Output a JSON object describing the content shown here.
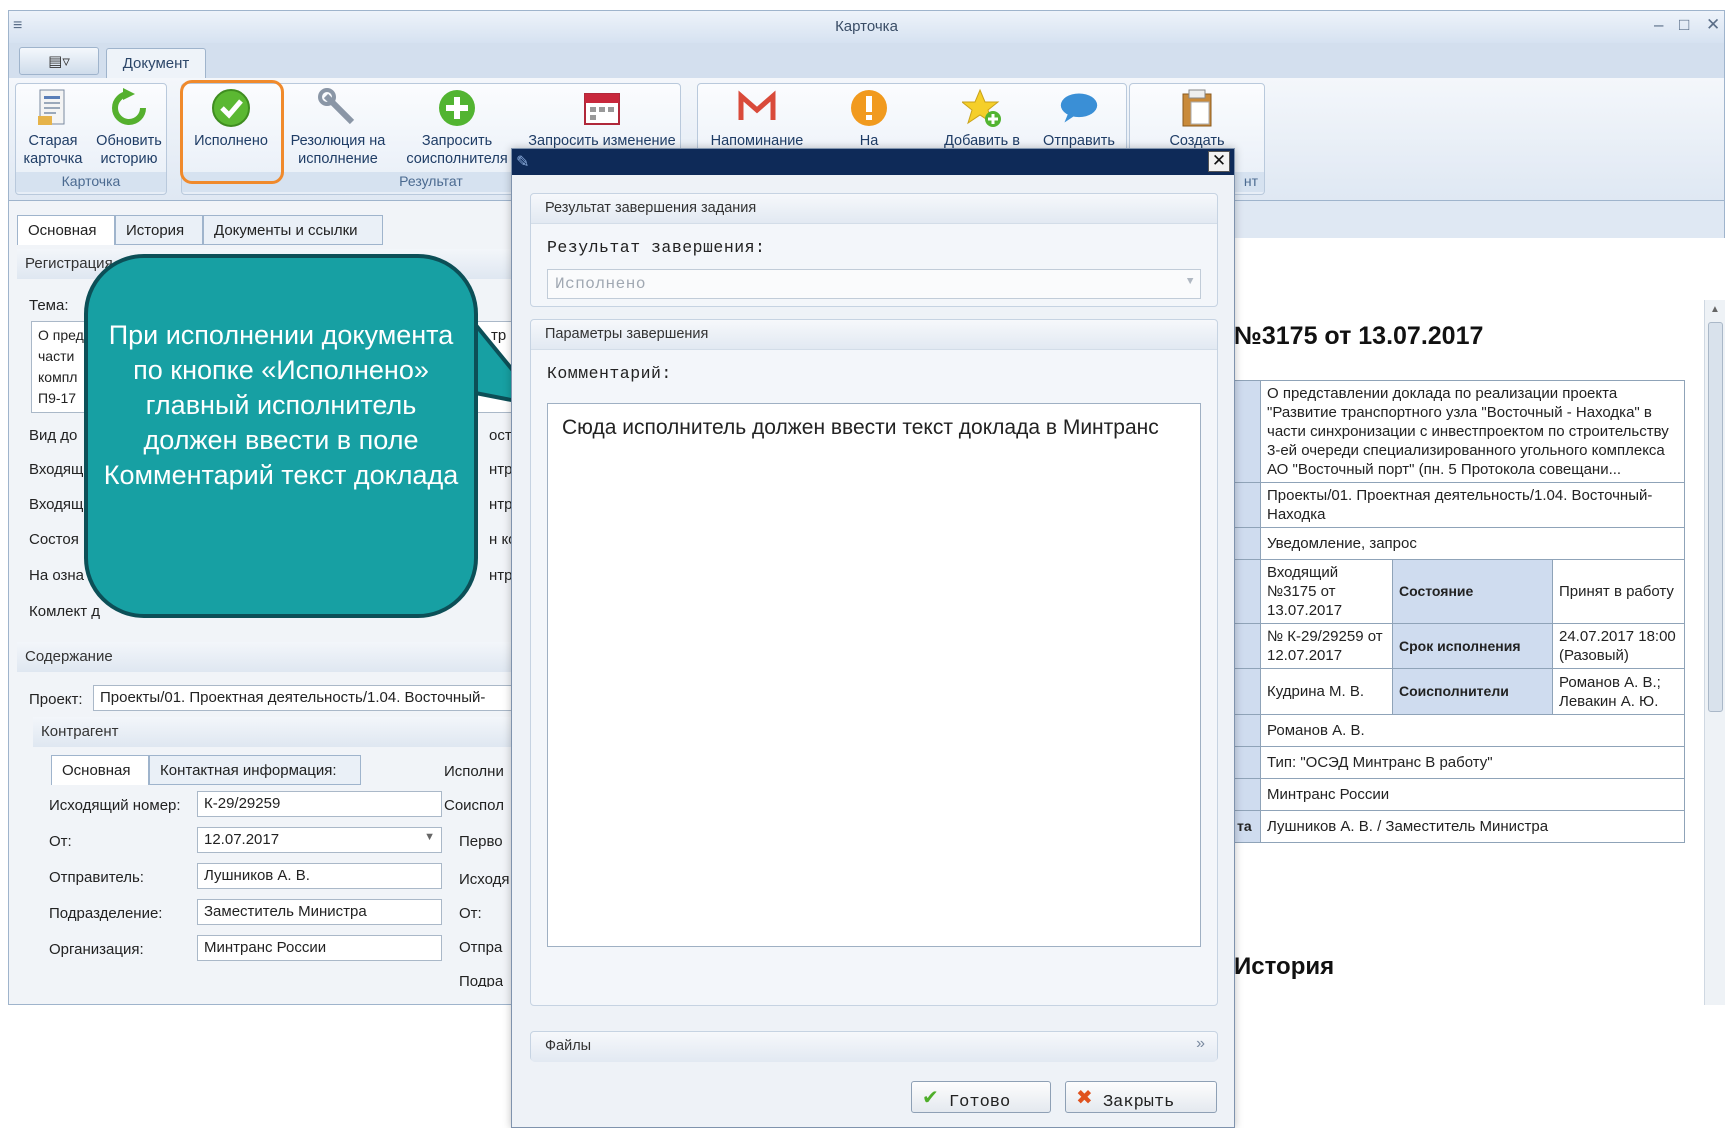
{
  "window": {
    "title": "Карточка",
    "minimize": "–",
    "maximize": "□",
    "close": "✕"
  },
  "ribbon": {
    "app_button": "▤▿",
    "tab": "Документ",
    "groups": {
      "card": "Карточка",
      "result": "Результат",
      "partial": "нт"
    },
    "buttons": {
      "old_card": "Старая\nкарточка",
      "refresh_history": "Обновить\nисторию",
      "executed": "Исполнено",
      "resolution": "Резолюция на\nисполнение",
      "request_coexecutor": "Запросить\nсоисполнителя",
      "request_change": "Запросить изменение",
      "reminder": "Напоминание",
      "to": "На",
      "add_to": "Добавить в",
      "send": "Отправить",
      "create": "Создать"
    }
  },
  "left_pane": {
    "tabs": [
      "Основная",
      "История",
      "Документы и ссылки"
    ],
    "registration": "Регистрация",
    "subject_label": "Тема:",
    "subject_lines": [
      "О пред",
      "части",
      "компл",
      "П9-17"
    ],
    "labels": [
      "Вид до",
      "Входящ",
      "Входящ",
      "Состоя",
      "На озна",
      "Комлект д"
    ],
    "right_fragments": [
      "тр",
      "оста",
      "нтро",
      "нтро",
      "н ко",
      "нтро"
    ],
    "content_header": "Содержание",
    "project_label": "Проект:",
    "project_value": "Проекты/01. Проектная деятельность/1.04. Восточный-",
    "counterparty": "Контрагент",
    "sub_tabs": [
      "Основная",
      "Контактная информация:"
    ],
    "fields": [
      {
        "label": "Исходящий номер:",
        "value": "К-29/29259"
      },
      {
        "label": "От:",
        "value": "12.07.2017"
      },
      {
        "label": "Отправитель:",
        "value": "Лушников А. В."
      },
      {
        "label": "Подразделение:",
        "value": "Заместитель Министра"
      },
      {
        "label": "Организация:",
        "value": "Минтранс России"
      }
    ],
    "side_labels": [
      "Исполни",
      "Соиспол",
      "Перво",
      "Исходя",
      "От:",
      "Отпра",
      "Подра"
    ]
  },
  "document": {
    "title": "№3175 от 13.07.2017",
    "subject": "О представлении доклада по реализации проекта \"Развитие транспортного узла \"Восточный - Находка\" в части синхронизации с инвестпроектом по строительству 3-ей очереди специализированного угольного комплекса АО \"Восточный порт\" (пн. 5 Протокола совещани...",
    "project": "Проекты/01. Проектная деятельность/1.04. Восточный-Находка",
    "type": "Уведомление, запрос",
    "incoming": "Входящий №3175 от 13.07.2017",
    "state_label": "Состояние",
    "state_value": "Принят в работу",
    "outgoing": "№ К-29/29259 от 12.07.2017",
    "deadline_label": "Срок исполнения",
    "deadline_value": "24.07.2017 18:00 (Разовый)",
    "executor": "Кудрина М. В.",
    "coexecutors_label": "Соисполнители",
    "coexecutors_value": "Романов А. В.; Левакин А. Ю.",
    "responsible": "Романов А. В.",
    "route_type": "Тип: \"ОСЭД Минтранс В работу\"",
    "org": "Минтранс России",
    "sender_stub": "та",
    "sender": "Лушников А. В. / Заместитель Министра",
    "history_title": "История"
  },
  "dialog": {
    "panel1_header": "Результат завершения задания",
    "result_label": "Результат завершения:",
    "result_value": "Исполнено",
    "panel2_header": "Параметры завершения",
    "comment_label": "Комментарий:",
    "comment_value": "Сюда исполнитель должен ввести текст доклада в Минтранс",
    "files_header": "Файлы",
    "ok_label": "Готово",
    "close_label": "Закрыть",
    "close_x": "✕"
  },
  "callout": {
    "text": "При исполнении документа по кнопке «Исполнено» главный исполнитель должен ввести в поле Комментарий текст доклада",
    "fill": "#17a0a3",
    "border": "#0c4f57"
  },
  "colors": {
    "accent_highlight": "#f08a2c",
    "dialog_title": "#0e2a58",
    "ribbon_label": "#4b6a90"
  }
}
